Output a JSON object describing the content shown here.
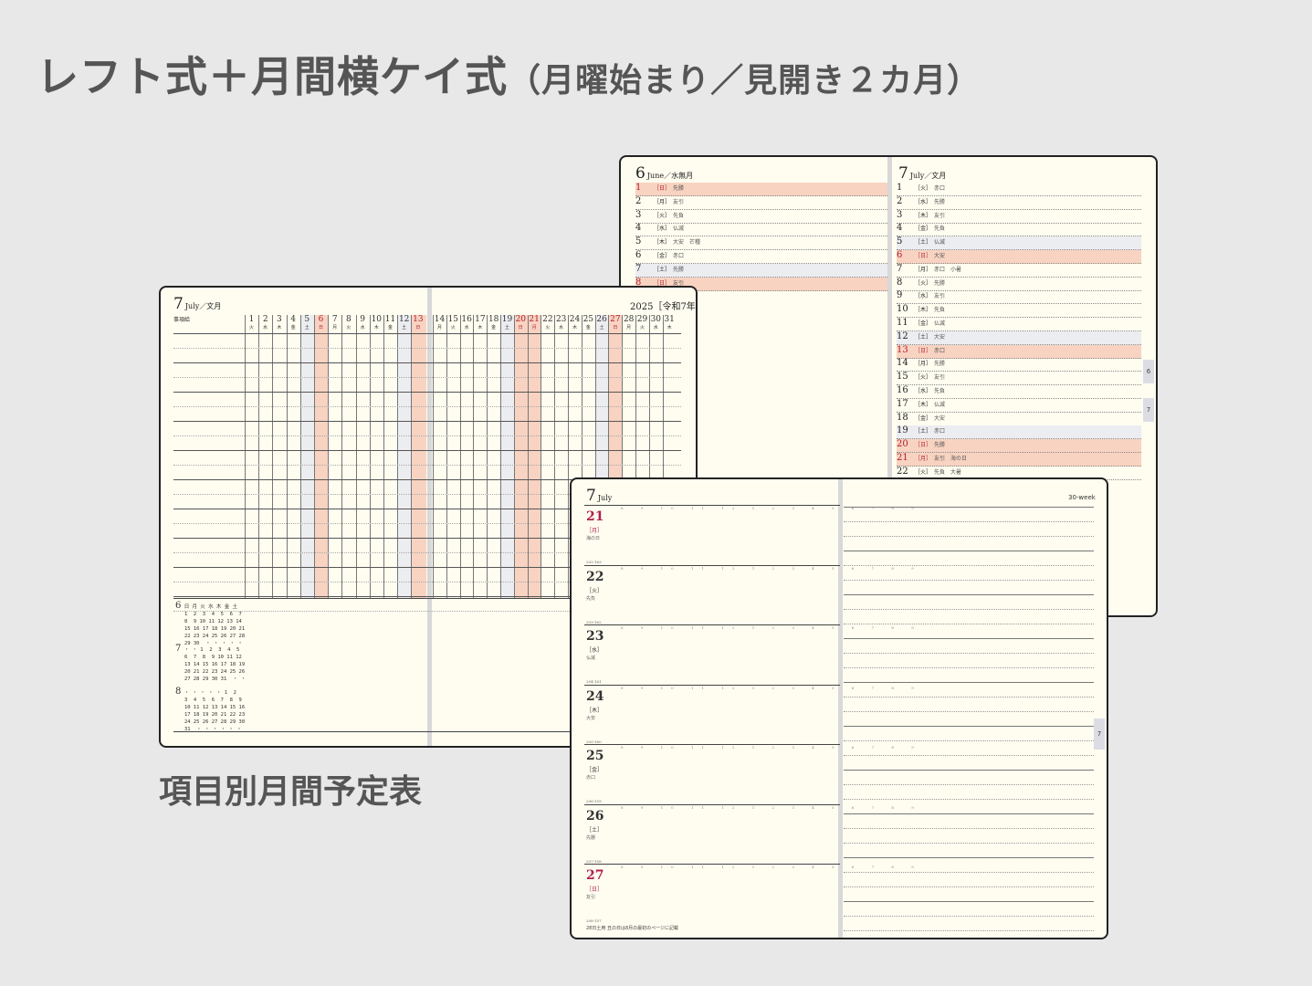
{
  "headline": {
    "main": "レフト式＋月間横ケイ式",
    "sub": "（月曜始まり／見開き２カ月）"
  },
  "caption": "項目別月間予定表",
  "monthly": {
    "left": {
      "month": "6",
      "title": "June／水無月"
    },
    "right": {
      "month": "7",
      "title": "July／文月"
    },
    "tabs": [
      "6",
      "7"
    ],
    "june": [
      {
        "d": "1",
        "w": "［日］",
        "e": "先勝",
        "type": "sun"
      },
      {
        "d": "2",
        "w": "［月］",
        "e": "友引",
        "type": ""
      },
      {
        "d": "3",
        "w": "［火］",
        "e": "先負",
        "type": ""
      },
      {
        "d": "4",
        "w": "［水］",
        "e": "仏滅",
        "type": ""
      },
      {
        "d": "5",
        "w": "［木］",
        "e": "大安　芒種",
        "type": ""
      },
      {
        "d": "6",
        "w": "［金］",
        "e": "赤口",
        "type": ""
      },
      {
        "d": "7",
        "w": "［土］",
        "e": "先勝",
        "type": "sat"
      },
      {
        "d": "8",
        "w": "［日］",
        "e": "友引",
        "type": "sun"
      }
    ],
    "july": [
      {
        "d": "1",
        "w": "［火］",
        "e": "赤口",
        "type": ""
      },
      {
        "d": "2",
        "w": "［水］",
        "e": "先勝",
        "type": ""
      },
      {
        "d": "3",
        "w": "［木］",
        "e": "友引",
        "type": ""
      },
      {
        "d": "4",
        "w": "［金］",
        "e": "先負",
        "type": ""
      },
      {
        "d": "5",
        "w": "［土］",
        "e": "仏滅",
        "type": "sat"
      },
      {
        "d": "6",
        "w": "［日］",
        "e": "大安",
        "type": "sun"
      },
      {
        "d": "7",
        "w": "［月］",
        "e": "赤口　小暑",
        "type": ""
      },
      {
        "d": "8",
        "w": "［火］",
        "e": "先勝",
        "type": ""
      },
      {
        "d": "9",
        "w": "［水］",
        "e": "友引",
        "type": ""
      },
      {
        "d": "10",
        "w": "［木］",
        "e": "先負",
        "type": ""
      },
      {
        "d": "11",
        "w": "［金］",
        "e": "仏滅",
        "type": ""
      },
      {
        "d": "12",
        "w": "［土］",
        "e": "大安",
        "type": "sat"
      },
      {
        "d": "13",
        "w": "［日］",
        "e": "赤口",
        "type": "sun"
      },
      {
        "d": "14",
        "w": "［月］",
        "e": "先勝",
        "type": ""
      },
      {
        "d": "15",
        "w": "［火］",
        "e": "友引",
        "type": ""
      },
      {
        "d": "16",
        "w": "［水］",
        "e": "先負",
        "type": ""
      },
      {
        "d": "17",
        "w": "［木］",
        "e": "仏滅",
        "type": ""
      },
      {
        "d": "18",
        "w": "［金］",
        "e": "大安",
        "type": ""
      },
      {
        "d": "19",
        "w": "［土］",
        "e": "赤口",
        "type": "sat"
      },
      {
        "d": "20",
        "w": "［日］",
        "e": "先勝",
        "type": "sun"
      },
      {
        "d": "21",
        "w": "［月］",
        "e": "友引　海の日",
        "type": "sun"
      },
      {
        "d": "22",
        "w": "［火］",
        "e": "先負　大暑",
        "type": ""
      }
    ]
  },
  "project": {
    "month": "7",
    "title": "July／文月",
    "year": "2025［令和7年］",
    "item_label": "事項給",
    "days1": [
      {
        "d": "1",
        "w": "火"
      },
      {
        "d": "2",
        "w": "水"
      },
      {
        "d": "3",
        "w": "木"
      },
      {
        "d": "4",
        "w": "金"
      },
      {
        "d": "5",
        "w": "土",
        "t": "sat"
      },
      {
        "d": "6",
        "w": "日",
        "t": "sun"
      },
      {
        "d": "7",
        "w": "月"
      },
      {
        "d": "8",
        "w": "火"
      },
      {
        "d": "9",
        "w": "水"
      },
      {
        "d": "10",
        "w": "木"
      },
      {
        "d": "11",
        "w": "金"
      },
      {
        "d": "12",
        "w": "土",
        "t": "sat"
      },
      {
        "d": "13",
        "w": "日",
        "t": "sun"
      }
    ],
    "days2": [
      {
        "d": "14",
        "w": "月"
      },
      {
        "d": "15",
        "w": "火"
      },
      {
        "d": "16",
        "w": "水"
      },
      {
        "d": "17",
        "w": "木"
      },
      {
        "d": "18",
        "w": "金"
      },
      {
        "d": "19",
        "w": "土",
        "t": "sat"
      },
      {
        "d": "20",
        "w": "日",
        "t": "sun"
      },
      {
        "d": "21",
        "w": "月",
        "t": "sun"
      },
      {
        "d": "22",
        "w": "火"
      },
      {
        "d": "23",
        "w": "水"
      },
      {
        "d": "24",
        "w": "木"
      },
      {
        "d": "25",
        "w": "金"
      },
      {
        "d": "26",
        "w": "土",
        "t": "sat"
      },
      {
        "d": "27",
        "w": "日",
        "t": "sun"
      },
      {
        "d": "28",
        "w": "月"
      },
      {
        "d": "29",
        "w": "火"
      },
      {
        "d": "30",
        "w": "水"
      },
      {
        "d": "31",
        "w": "木"
      }
    ],
    "minis": [
      {
        "m": "6",
        "rows": [
          "日 月 火 水 木 金 土",
          "1  2  3  4  5  6  7",
          "8  9 10 11 12 13 14",
          "15 16 17 18 19 20 21",
          "22 23 24 25 26 27 28",
          "29 30  ・ ・ ・ ・ ・"
        ]
      },
      {
        "m": "7",
        "rows": [
          "・ ・ 1  2  3  4  5",
          "6  7  8  9 10 11 12",
          "13 14 15 16 17 18 19",
          "20 21 22 23 24 25 26",
          "27 28 29 30 31  ・ ・"
        ]
      },
      {
        "m": "8",
        "rows": [
          "・ ・ ・ ・ ・ 1  2",
          "3  4  5  6  7  8  9",
          "10 11 12 13 14 15 16",
          "17 18 19 20 21 22 23",
          "24 25 26 27 28 29 30",
          "31  ・ ・ ・ ・ ・ ・"
        ]
      }
    ]
  },
  "weekly": {
    "month": "7",
    "title": "July",
    "week": "30-week",
    "tab": "7",
    "hours": "8 9 10 11 12 1 2 3 4 5 6 7 8 9",
    "days": [
      {
        "d": "21",
        "w": "［月］",
        "e": "海の日",
        "n": "202-163",
        "type": "sun"
      },
      {
        "d": "22",
        "w": "［火］",
        "e": "先負",
        "n": "203-162",
        "type": ""
      },
      {
        "d": "23",
        "w": "［水］",
        "e": "仏滅",
        "n": "204-161",
        "type": ""
      },
      {
        "d": "24",
        "w": "［木］",
        "e": "大安",
        "n": "205-160",
        "type": ""
      },
      {
        "d": "25",
        "w": "［金］",
        "e": "赤口",
        "n": "206-159",
        "type": ""
      },
      {
        "d": "26",
        "w": "［土］",
        "e": "先勝",
        "n": "207-158",
        "type": ""
      },
      {
        "d": "27",
        "w": "［日］",
        "e": "友引",
        "n": "208-157",
        "type": "sun"
      }
    ],
    "footnote": "28日土用 丑の日は8月の最初のページに記載"
  }
}
